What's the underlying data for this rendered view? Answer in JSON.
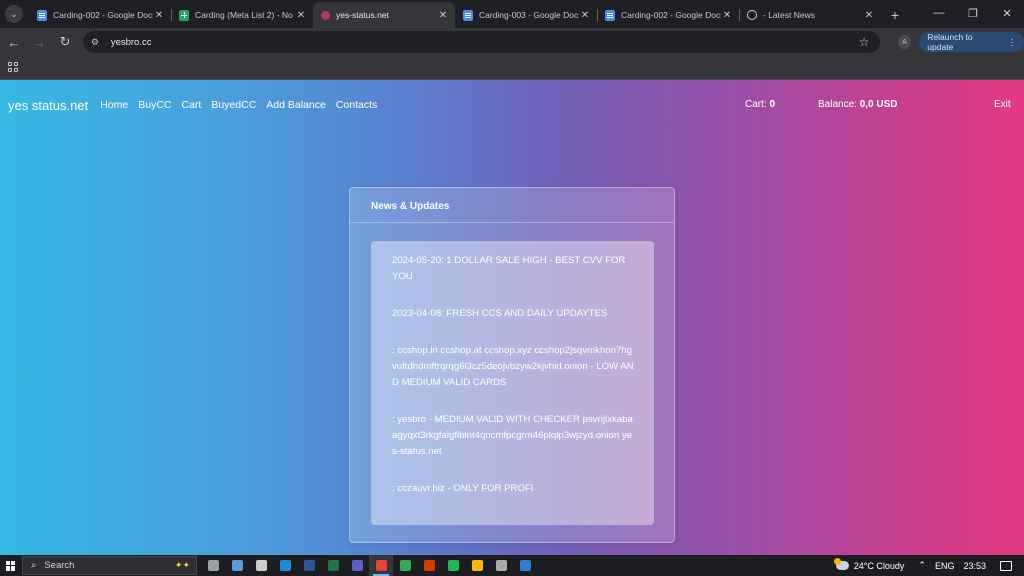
{
  "browser": {
    "tabs": [
      {
        "title": "Carding-002 - Google Docs",
        "icon": "docs-icon",
        "active": false
      },
      {
        "title": "Carding (Meta List 2) - No",
        "icon": "sheets-icon",
        "active": false
      },
      {
        "title": "yes-status.net",
        "icon": "site-icon",
        "active": true
      },
      {
        "title": "Carding-003 - Google Docs",
        "icon": "docs-icon",
        "active": false
      },
      {
        "title": "Carding-002 - Google Docs",
        "icon": "docs-icon",
        "active": false
      },
      {
        "title": "- Latest News",
        "icon": "globe-icon",
        "active": false
      }
    ],
    "close_glyph": "✕",
    "new_tab_glyph": "+",
    "url": "yesbro.cc",
    "profile_initial": "A",
    "relaunch_label": "Relaunch to update"
  },
  "site": {
    "brand": "yes status.net",
    "nav": [
      "Home",
      "BuyCC",
      "Cart",
      "BuyedCC",
      "Add Balance",
      "Contacts"
    ],
    "cart_label": "Cart:",
    "cart_value": "0",
    "balance_label": "Balance:",
    "balance_value": "0,0 USD",
    "exit_label": "Exit"
  },
  "news": {
    "title": "News & Updates",
    "items": [
      "2024-05-20: 1 DOLLAR SALE HIGH - BEST CVV FOR YOU",
      "2023-04-08: FRESH CCS AND DAILY UPDAYTES",
      ": ccshop.in ccshop.at ccshop.xyz ccshop2jsqvmkhon7hgvuftdhdmftrqrqg6l3cz5deojvbzyw2kjvhid.onion - LOW AND MEDIUM VALID CARDS",
      ": yesbro - MEDIUM VALID WITH CHECKER psvnjlxkabaagyqxt3rkgfaigflblnt4qncmfpcgrm46plqlp3wjzyd.onion yes-status.net",
      ": cczauvr.biz - ONLY FOR PROFI"
    ]
  },
  "taskbar": {
    "search_label": "Search",
    "weather": "24°C  Cloudy",
    "language": "ENG",
    "time": "23:53",
    "pinned_colors": [
      "#9aa0a6",
      "#5b9bd5",
      "#cccccc",
      "#1e8bd7",
      "#2b579a",
      "#217346",
      "#5b5fc7",
      "#ea4335",
      "#34a853",
      "#d83b01",
      "#1db954",
      "#ffb900",
      "#aaaaaa",
      "#2d7dd2"
    ]
  }
}
